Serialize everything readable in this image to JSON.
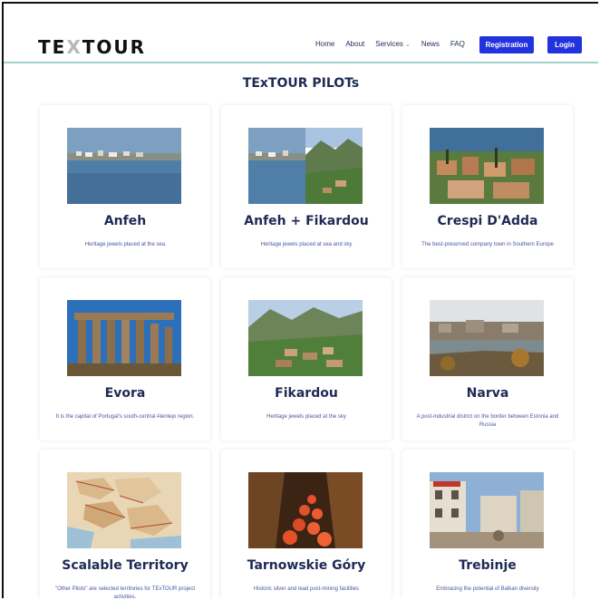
{
  "brand": {
    "logo_left": "TE",
    "logo_x": "X",
    "logo_right": "TOUR"
  },
  "nav": {
    "items": [
      "Home",
      "About",
      "Services",
      "News",
      "FAQ"
    ],
    "register_label": "Registration",
    "login_label": "Login"
  },
  "page": {
    "title": "TExTOUR PILOTs"
  },
  "pilots": [
    {
      "name": "Anfeh",
      "description": "Heritage jewels placed at the sea",
      "icon": "seaside-village-image"
    },
    {
      "name": "Anfeh + Fikardou",
      "description": "Heritage jewels placed at sea and sky",
      "icon": "seaside-mountain-village-image"
    },
    {
      "name": "Crespi D'Adda",
      "description": "The best-preserved company town in Southern Europe",
      "icon": "company-town-image"
    },
    {
      "name": "Evora",
      "description": "It is the capital of Portugal's south-central Alentejo region.",
      "icon": "roman-temple-image"
    },
    {
      "name": "Fikardou",
      "description": "Heritage jewels placed at the sky",
      "icon": "mountain-village-image"
    },
    {
      "name": "Narva",
      "description": "A post-industrial district on the border between Estonia and Russia",
      "icon": "river-town-image"
    },
    {
      "name": "Scalable Territory",
      "description": "\"Other Pilots\" are selected territories for TExTOUR project activities.",
      "icon": "europe-map-image"
    },
    {
      "name": "Tarnowskie Góry",
      "description": "Historic silver and lead post-mining facilities",
      "icon": "mine-tunnel-image"
    },
    {
      "name": "Trebinje",
      "description": "Embracing the potential of Balkan diversity",
      "icon": "town-square-image"
    }
  ],
  "colors": {
    "accent": "#2233dd",
    "heading": "#1f2a55",
    "divider": "#9fd3d0"
  }
}
